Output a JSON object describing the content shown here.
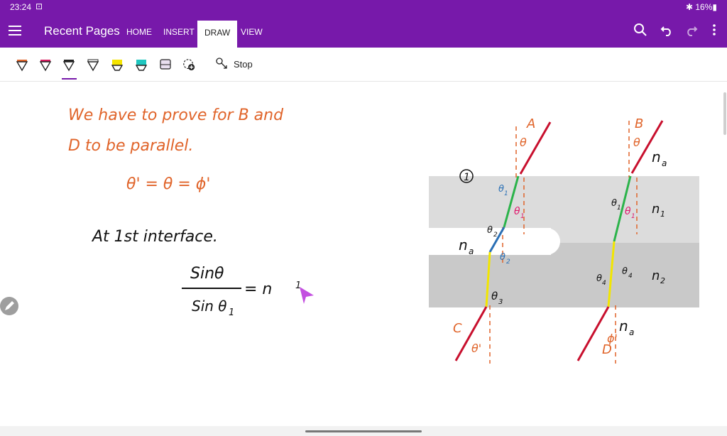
{
  "status": {
    "time": "23:24",
    "time_icon": "screenshot-icon",
    "battery": "✱ 16%▮"
  },
  "app": {
    "title": "Recent Pages",
    "tabs": [
      {
        "label": "HOME"
      },
      {
        "label": "INSERT"
      },
      {
        "label": "DRAW",
        "active": true
      },
      {
        "label": "VIEW"
      }
    ],
    "accent": "#7719aa"
  },
  "ribbon": {
    "pens": [
      {
        "name": "pen-orange",
        "color": "#e0642a"
      },
      {
        "name": "pen-magenta",
        "color": "#d81b60"
      },
      {
        "name": "pen-black",
        "color": "#222222",
        "selected": true
      },
      {
        "name": "pen-white",
        "color": "#ffffff"
      },
      {
        "name": "highlighter-yellow",
        "color": "#f5e400"
      },
      {
        "name": "highlighter-teal",
        "color": "#1fc7c0"
      },
      {
        "name": "highlighter-lavender",
        "color": "#c9b5d9"
      }
    ],
    "stop_label": "Stop"
  },
  "notes": {
    "line1a": "We  have  to  prove  for  B  and",
    "line1b": "D  to  be  parallel.",
    "eq1": "θ' = θ = ϕ'",
    "line2": "At  1st  interface.",
    "frac_num": "Sinθ",
    "frac_den": "Sin θ",
    "frac_den_sub": "1",
    "eq_rhs": "= n",
    "eq_rhs_sub": "1"
  },
  "diagram": {
    "circle_label": "1",
    "A": "A",
    "B": "B",
    "C": "C",
    "D": "D",
    "theta": "θ",
    "theta1": "θ",
    "sub1": "1",
    "theta2": "θ",
    "sub2": "2",
    "theta3": "θ",
    "sub3": "3",
    "theta4": "θ",
    "sub4": "4",
    "theta_prime": "θ'",
    "phi_prime": "ϕ'",
    "na": "n",
    "na_sub": "a",
    "n1": "n",
    "n1_sub": "1",
    "n2": "n",
    "n2_sub": "2"
  },
  "colors": {
    "ink_orange": "#e0642a",
    "ink_red": "#c8102e",
    "ink_green": "#2bb34a",
    "ink_yellow": "#f2e600",
    "ink_blue": "#2a6fb5",
    "ink_magenta": "#e0186c",
    "slab1": "#dcdcdc",
    "slab2": "#c9c9c9"
  }
}
